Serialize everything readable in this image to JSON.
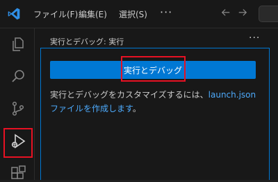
{
  "titlebar": {
    "menus": [
      "ファイル(F)",
      "編集(E)",
      "選択(S)"
    ],
    "more": "···"
  },
  "activity_bar": {
    "items": [
      "explorer-icon",
      "search-icon",
      "source-control-icon",
      "run-debug-icon",
      "extensions-icon"
    ],
    "active": "run-debug-icon"
  },
  "panel": {
    "title": "実行とデバッグ: 実行",
    "more": "···",
    "run_button_label": "実行とデバッグ",
    "description_prefix": "実行とデバッグをカスタマイズするには、",
    "description_link": "launch.json ファイルを作成します",
    "description_suffix": "。"
  },
  "colors": {
    "accent": "#0078d4",
    "link": "#4daafc",
    "highlight": "#e81123",
    "background": "#1f1f1f"
  }
}
